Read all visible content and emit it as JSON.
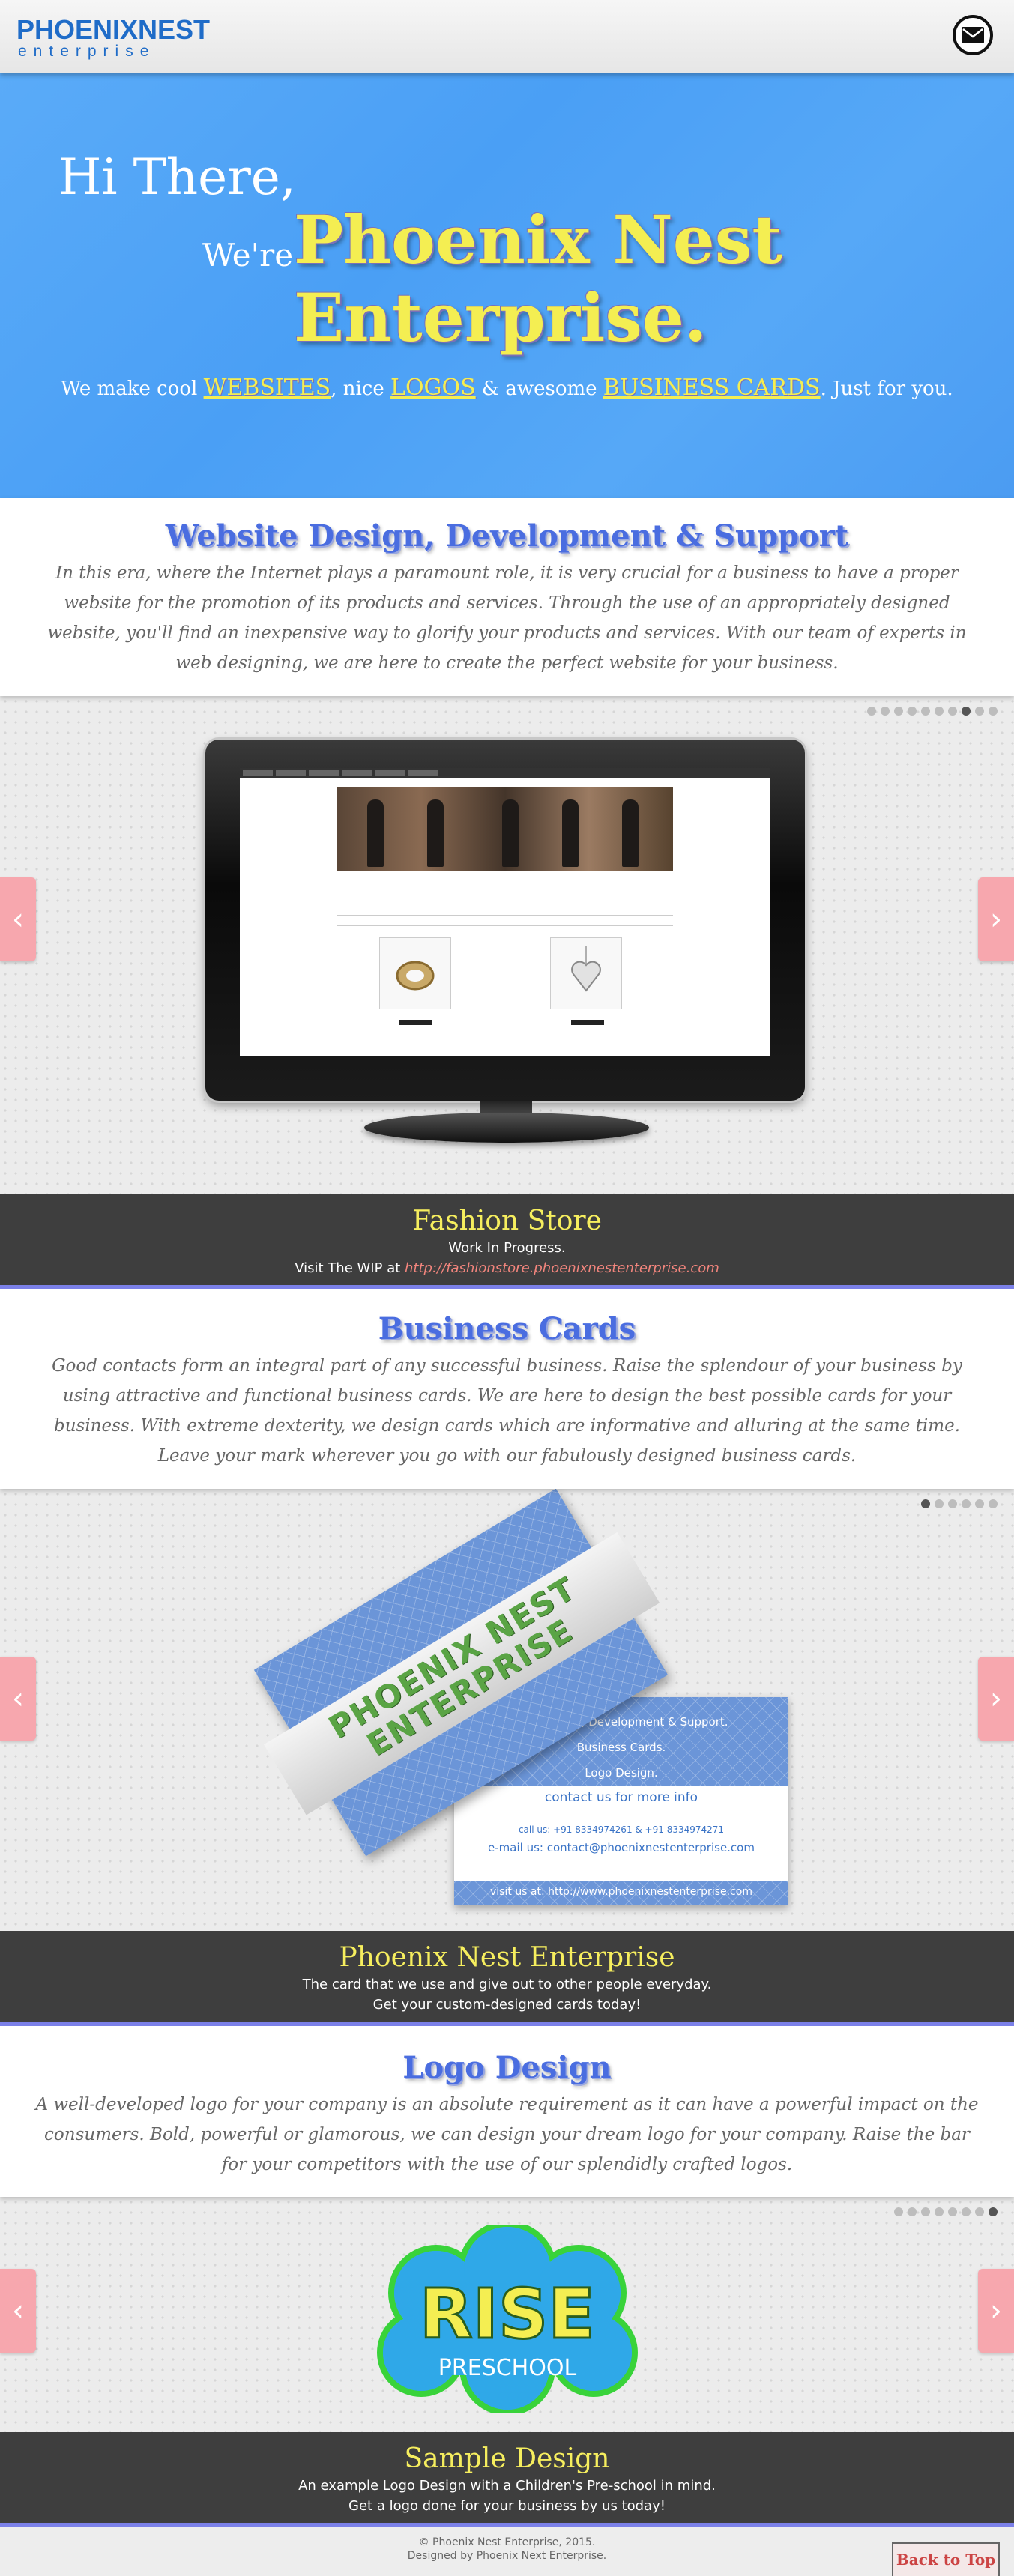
{
  "header": {
    "logo_top": "PHOENIXNEST",
    "logo_bottom": "enterprise",
    "mail_icon": "envelope-icon"
  },
  "hero": {
    "greeting": "Hi There,",
    "were": "We're",
    "title_line1": "Phoenix Nest",
    "title_line2": "Enterprise.",
    "sub_1": "We make cool ",
    "sub_websites": "WEBSITES",
    "sub_2": ", nice ",
    "sub_logos": "LOGOS",
    "sub_3": " & awesome ",
    "sub_cards": "BUSINESS CARDS",
    "sub_4": ". Just for you."
  },
  "web_section": {
    "title": "Website Design, Development & Support",
    "text": "In this era, where the Internet plays a paramount role, it is very crucial for a business to have a proper website for the promotion of its products and services. Through the use of an appropriately designed website, you'll find an inexpensive way to glorify your products and services. With our team of experts in web designing, we are here to create the perfect website for your business.",
    "dots": 10,
    "active_dot": 7,
    "caption_title": "Fashion Store",
    "caption_line1": "Work In Progress.",
    "caption_line2": "Visit The WIP at ",
    "caption_link": "http://fashionstore.phoenixnestenterprise.com"
  },
  "cards_section": {
    "title": "Business Cards",
    "text": "Good contacts form an integral part of any successful business. Raise the splendour of your business by using attractive and functional business cards. We are here to design the best possible cards for your business. With extreme dexterity, we design cards which are informative and alluring at the same time. Leave your mark wherever you go with our fabulously designed business cards.",
    "dots": 6,
    "active_dot": 0,
    "card_brand_1": "PHOENIX NEST",
    "card_brand_2": "ENTERPRISE",
    "card_lines": [
      "Web Design, Development & Support.",
      "Business Cards.",
      "Logo Design."
    ],
    "card_contact": "contact us for more info",
    "card_call": "call us: +91 8334974261 & +91 8334974271",
    "card_email": "e-mail us: contact@phoenixnestenterprise.com",
    "card_visit": "visit us at: http://www.phoenixnestenterprise.com",
    "caption_title": "Phoenix Nest Enterprise",
    "caption_line1": "The card that we use and give out to other people everyday.",
    "caption_line2": "Get your custom-designed cards today!"
  },
  "logo_section": {
    "title": "Logo Design",
    "text": "A well-developed logo for your company is an absolute requirement as it can have a powerful impact on the consumers. Bold, powerful or glamorous, we can design your dream logo for your company. Raise the bar for your competitors with the use of our splendidly crafted logos.",
    "dots": 8,
    "active_dot": 7,
    "logo_word": "RISE",
    "logo_sub": "PRESCHOOL",
    "caption_title": "Sample Design",
    "caption_line1": "An example Logo Design with a Children's Pre-school in mind.",
    "caption_line2": "Get a logo done for your business by us today!"
  },
  "footer": {
    "line1": "© Phoenix Nest Enterprise, 2015.",
    "line2": "Designed by Phoenix Next Enterprise.",
    "back_to_top": "Back to Top"
  },
  "colors": {
    "hero_blue": "#4a9ff5",
    "title_yellow": "#f4ee52",
    "heading_blue": "#4a6de0",
    "caption_bg": "#3e3e3e",
    "arrow_pink": "#f7a7ae"
  }
}
